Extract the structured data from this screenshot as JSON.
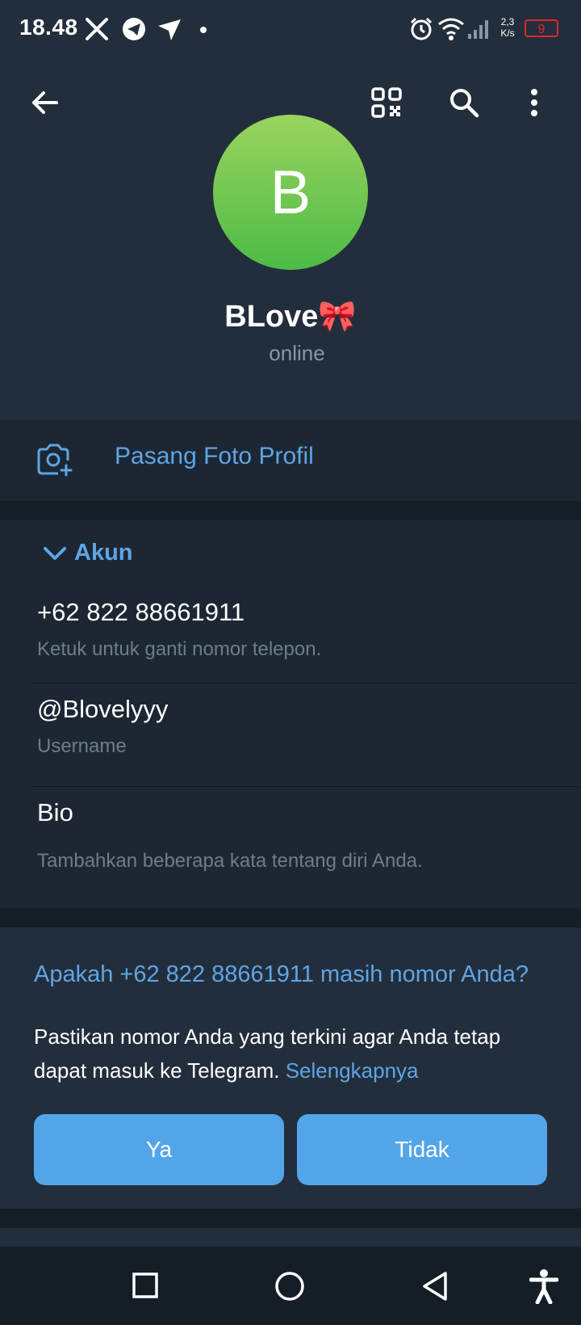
{
  "status_bar": {
    "time": "18.48",
    "network_speed_value": "2,3",
    "network_speed_unit": "K/s",
    "battery_level": "9",
    "battery_color": "#e0262d",
    "icons": [
      "x-icon",
      "telegram-icon",
      "send-icon",
      "dot-icon",
      "alarm-icon",
      "wifi-icon",
      "signal-icon",
      "battery-icon"
    ]
  },
  "header": {
    "back_icon": "arrow-left-icon",
    "qr_icon": "qr-code-icon",
    "search_icon": "search-icon",
    "more_icon": "more-vertical-icon"
  },
  "profile": {
    "avatar_letter": "B",
    "avatar_colors": [
      "#9ad45f",
      "#4cbb46"
    ],
    "name": "BLove🎀",
    "status": "online"
  },
  "set_photo": {
    "label": "Pasang Foto Profil",
    "icon": "camera-add-icon"
  },
  "account": {
    "section_title": "Akun",
    "phone": "+62 822 88661911",
    "phone_hint": "Ketuk untuk ganti nomor telepon.",
    "username": "@Blovelyyy",
    "username_label": "Username",
    "bio_title": "Bio",
    "bio_hint": "Tambahkan beberapa kata tentang diri Anda."
  },
  "phone_check": {
    "question": "Apakah +62 822 88661911 masih nomor Anda?",
    "body_line1": "Pastikan nomor Anda yang terkini agar Anda tetap",
    "body_line2": "dapat masuk ke Telegram.",
    "learn_more": "Selengkapnya",
    "yes_label": "Ya",
    "no_label": "Tidak"
  },
  "nav_bar": {
    "recents_icon": "square-icon",
    "home_icon": "circle-icon",
    "back_icon": "triangle-back-icon",
    "accessibility_icon": "accessibility-icon"
  },
  "colors": {
    "accent": "#53a5ea",
    "link": "#5ea5e6",
    "background": "#1d2733",
    "header": "#232e3c"
  }
}
